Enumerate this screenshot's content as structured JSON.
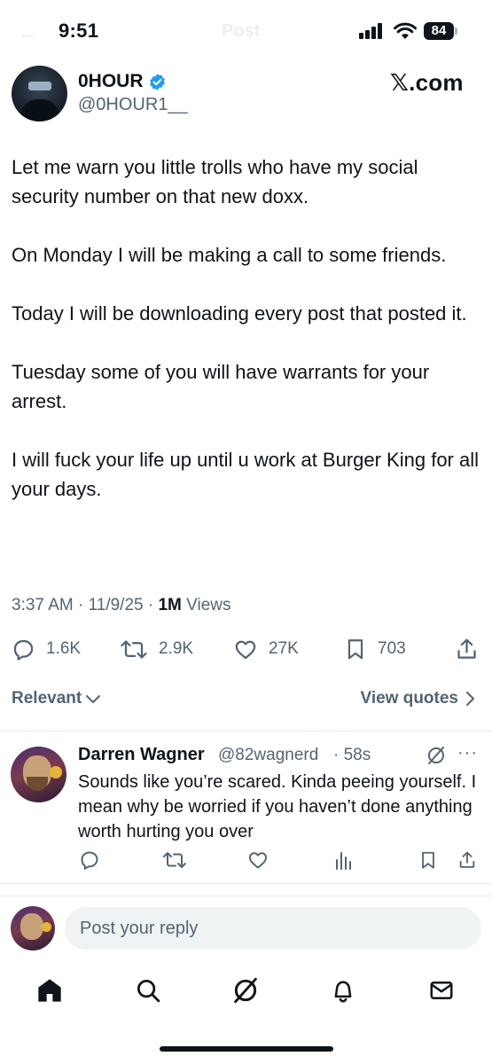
{
  "status_bar": {
    "time": "9:51",
    "header_title": "Post",
    "battery": "84"
  },
  "post": {
    "author": {
      "name": "0HOUR",
      "handle": "@0HOUR1__",
      "verified": true
    },
    "brand": "𝕏.com",
    "paragraphs": [
      "Let me warn you little trolls who have my social security number on that new doxx.",
      "On Monday I will be making a call to some friends.",
      "Today I will be downloading every post that posted it.",
      "Tuesday some of you will have warrants for your arrest.",
      "I will fuck your life up until u work at Burger King for all your days."
    ],
    "timestamp": "3:37 AM · 11/9/25 · ",
    "views_count": "1M",
    "views_label": " Views",
    "stats": {
      "replies": "1.6K",
      "reposts": "2.9K",
      "likes": "27K",
      "bookmarks": "703"
    }
  },
  "filters": {
    "sort_label": "Relevant",
    "view_quotes_label": "View quotes"
  },
  "reply": {
    "name": "Darren Wagner",
    "handle": "@82wagnerd",
    "time": "· 58s",
    "more": "···",
    "text": "Sounds like you’re scared. Kinda peeing yourself. I mean why be worried if you haven’t done anything worth hurting you over"
  },
  "composer": {
    "placeholder": "Post your reply"
  },
  "colors": {
    "text": "#0f1419",
    "secondary": "#536471",
    "verified_blue": "#1d9bf0",
    "input_bg": "#eff3f4",
    "divider": "#e6e9eb"
  },
  "icons": [
    "back-arrow-icon",
    "signal-icon",
    "wifi-icon",
    "battery-icon",
    "verified-badge-icon",
    "reply-icon",
    "repost-icon",
    "like-icon",
    "bookmark-icon",
    "share-icon",
    "chevron-down-icon",
    "chevron-right-icon",
    "grok-icon",
    "more-icon",
    "analytics-icon",
    "home-icon",
    "search-icon",
    "notifications-icon",
    "messages-icon"
  ]
}
